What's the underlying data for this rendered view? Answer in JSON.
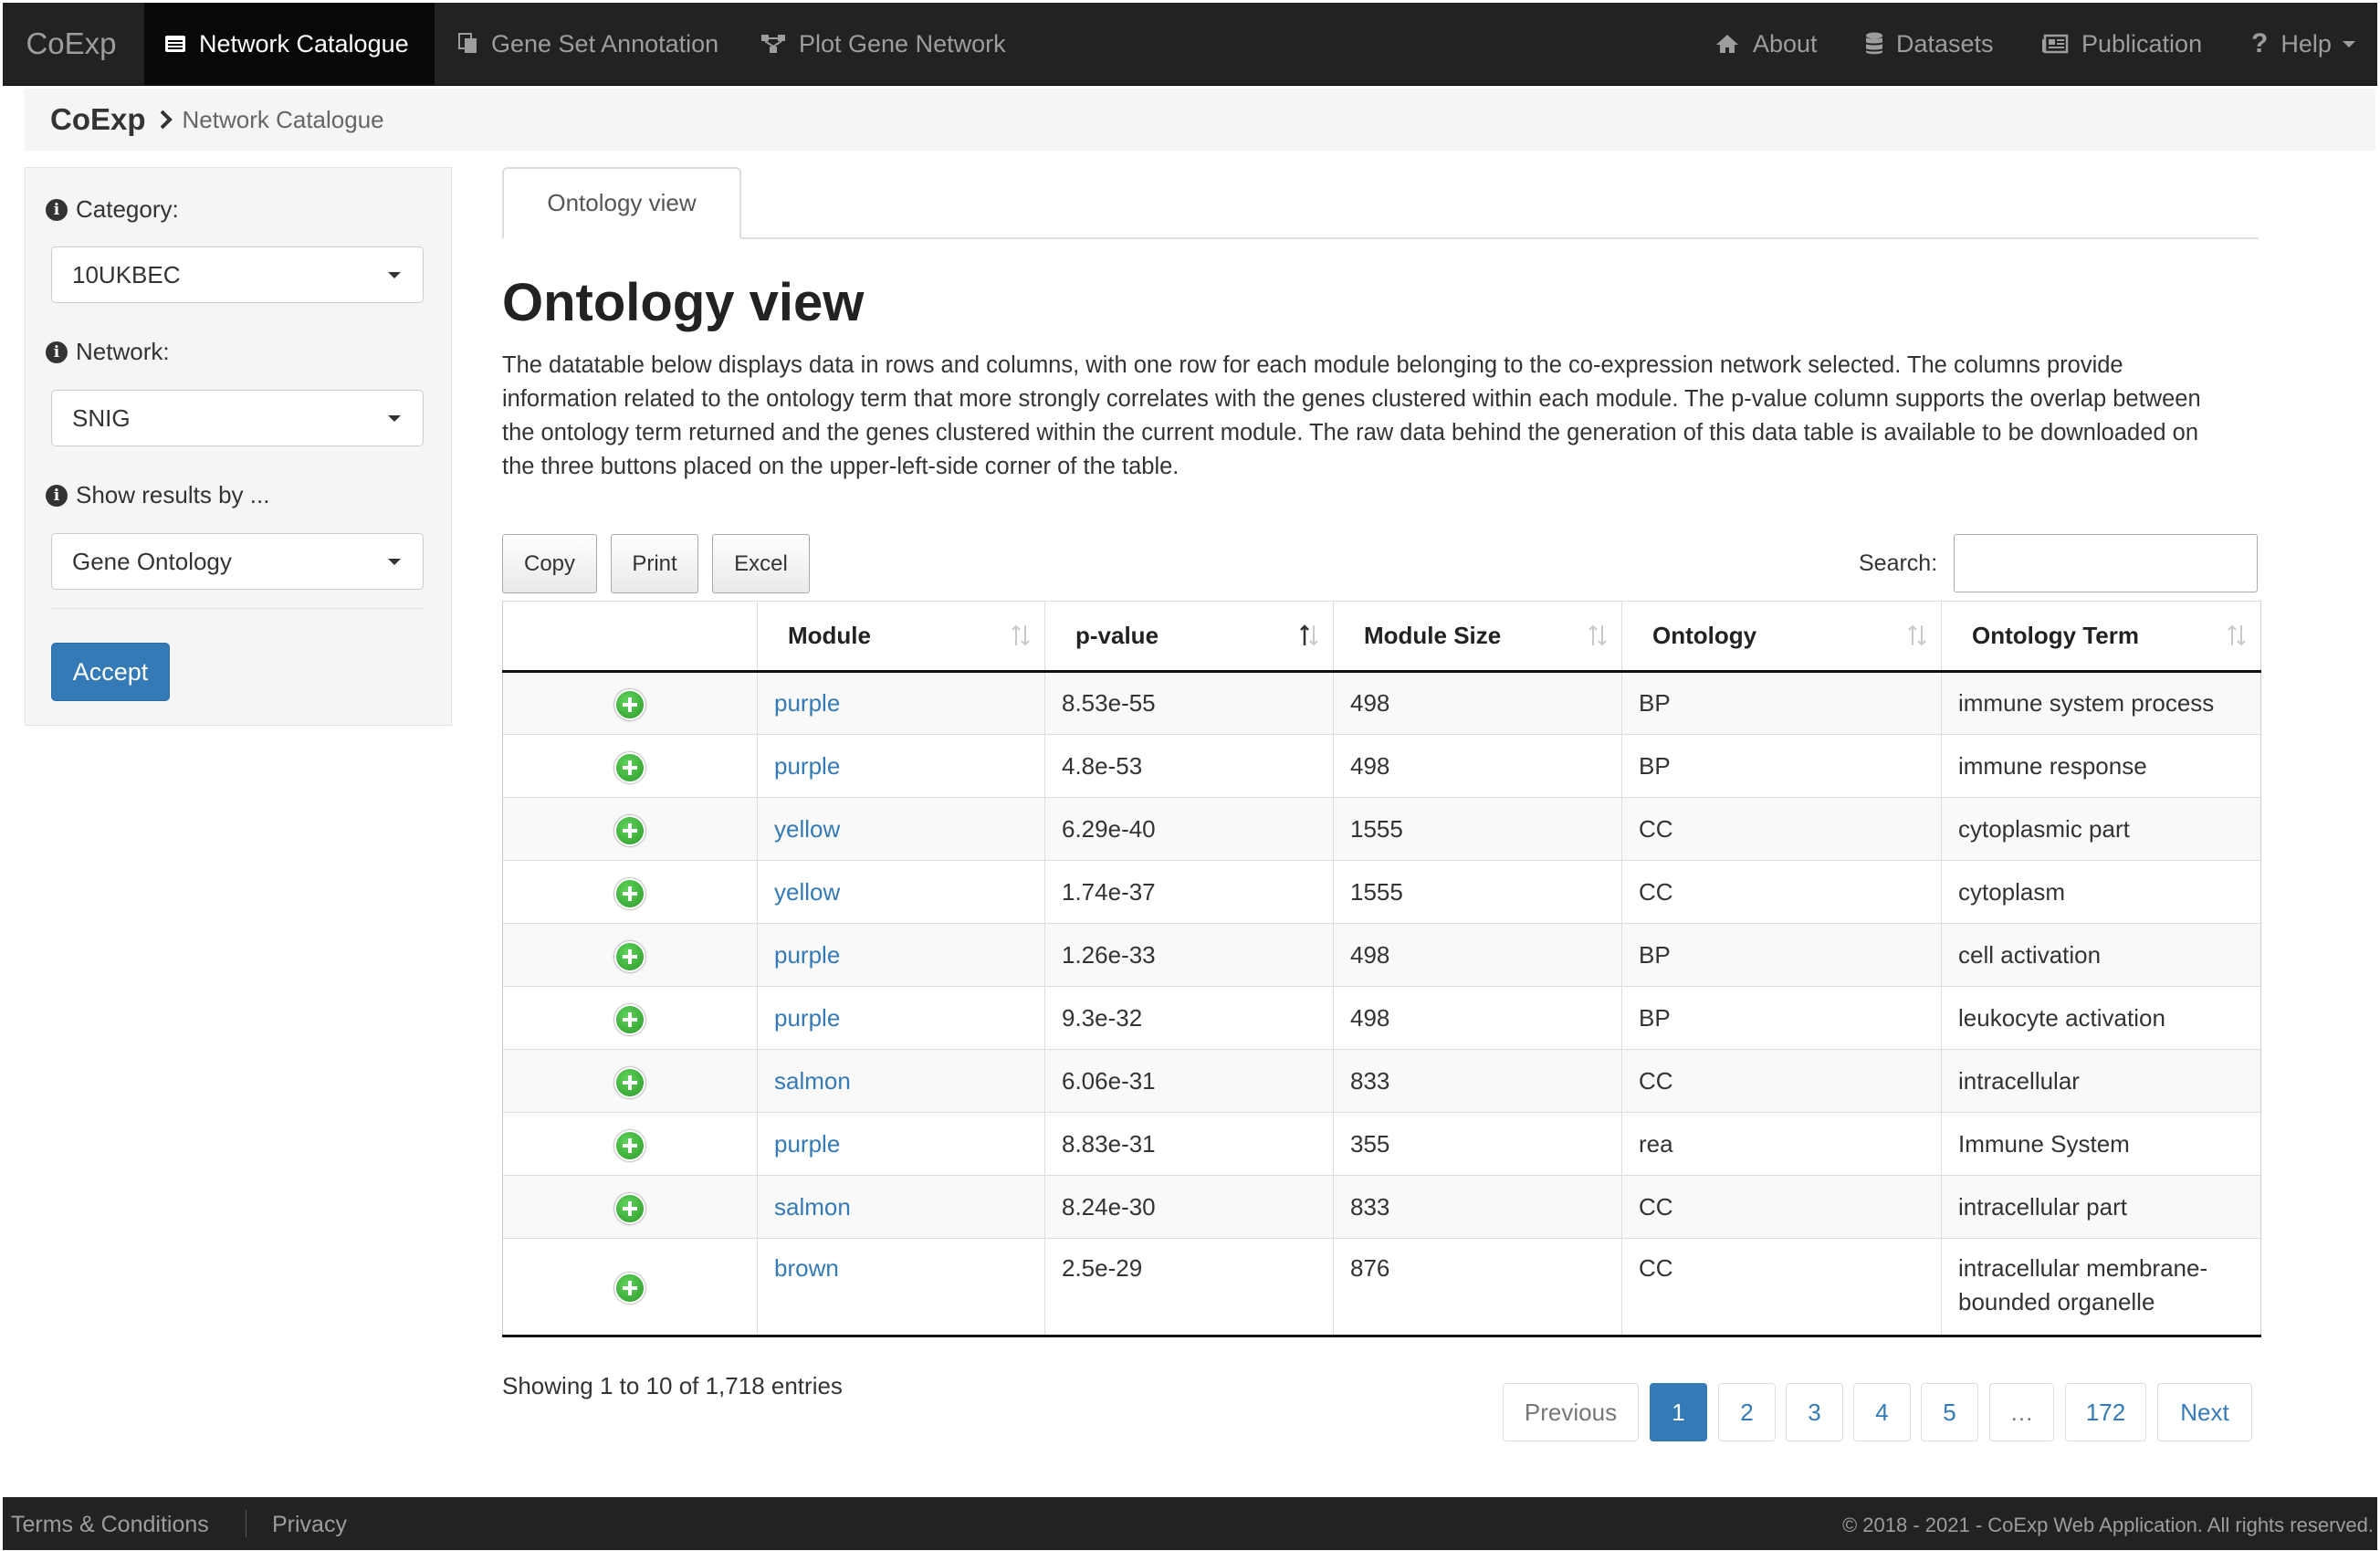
{
  "navbar": {
    "brand": "CoExp",
    "items": [
      {
        "label": "Network Catalogue",
        "icon": "list-icon",
        "active": true
      },
      {
        "label": "Gene Set Annotation",
        "icon": "copy-icon",
        "active": false
      },
      {
        "label": "Plot Gene Network",
        "icon": "network-icon",
        "active": false
      }
    ],
    "right_items": [
      {
        "label": "About",
        "icon": "home-icon"
      },
      {
        "label": "Datasets",
        "icon": "database-icon"
      },
      {
        "label": "Publication",
        "icon": "newspaper-icon"
      },
      {
        "label": "Help",
        "icon": "question-icon"
      }
    ]
  },
  "breadcrumb": {
    "root": "CoExp",
    "current": "Network Catalogue"
  },
  "sidebar": {
    "category": {
      "label": "Category:",
      "value": "10UKBEC"
    },
    "network": {
      "label": "Network:",
      "value": "SNIG"
    },
    "show_results": {
      "label": "Show results by ...",
      "value": "Gene Ontology"
    },
    "accept_label": "Accept"
  },
  "tab": {
    "label": "Ontology view"
  },
  "main": {
    "title": "Ontology view",
    "description": "The datatable below displays data in rows and columns, with one row for each module belonging to the co-expression network selected. The columns provide information related to the ontology term that more strongly correlates with the genes clustered within each module. The p-value column supports the overlap between the ontology term returned and the genes clustered within the current module. The raw data behind the generation of this data table is available to be downloaded on the three buttons placed on the upper-left-side corner of the table."
  },
  "table_controls": {
    "buttons": [
      "Copy",
      "Print",
      "Excel"
    ],
    "search_label": "Search:",
    "search_value": ""
  },
  "table": {
    "headers": [
      "",
      "Module",
      "p-value",
      "Module Size",
      "Ontology",
      "Ontology Term"
    ],
    "rows": [
      {
        "module": "purple",
        "pvalue": "8.53e-55",
        "size": "498",
        "ontology": "BP",
        "term": "immune system process"
      },
      {
        "module": "purple",
        "pvalue": "4.8e-53",
        "size": "498",
        "ontology": "BP",
        "term": "immune response"
      },
      {
        "module": "yellow",
        "pvalue": "6.29e-40",
        "size": "1555",
        "ontology": "CC",
        "term": "cytoplasmic part"
      },
      {
        "module": "yellow",
        "pvalue": "1.74e-37",
        "size": "1555",
        "ontology": "CC",
        "term": "cytoplasm"
      },
      {
        "module": "purple",
        "pvalue": "1.26e-33",
        "size": "498",
        "ontology": "BP",
        "term": "cell activation"
      },
      {
        "module": "purple",
        "pvalue": "9.3e-32",
        "size": "498",
        "ontology": "BP",
        "term": "leukocyte activation"
      },
      {
        "module": "salmon",
        "pvalue": "6.06e-31",
        "size": "833",
        "ontology": "CC",
        "term": "intracellular"
      },
      {
        "module": "purple",
        "pvalue": "8.83e-31",
        "size": "355",
        "ontology": "rea",
        "term": "Immune System"
      },
      {
        "module": "salmon",
        "pvalue": "8.24e-30",
        "size": "833",
        "ontology": "CC",
        "term": "intracellular part"
      },
      {
        "module": "brown",
        "pvalue": "2.5e-29",
        "size": "876",
        "ontology": "CC",
        "term": "intracellular membrane-bounded organelle"
      }
    ]
  },
  "table_info": "Showing 1 to 10 of 1,718 entries",
  "pagination": {
    "previous": "Previous",
    "pages": [
      "1",
      "2",
      "3",
      "4",
      "5",
      "…",
      "172"
    ],
    "next": "Next",
    "active": "1"
  },
  "footer": {
    "links": [
      "Terms & Conditions",
      "Privacy"
    ],
    "copyright": "© 2018 - 2021 - CoExp Web Application. All rights reserved."
  },
  "colors": {
    "navbar": "#222222",
    "primary": "#337ab7",
    "link": "#337ab7",
    "plus": "#2e9a2b"
  }
}
